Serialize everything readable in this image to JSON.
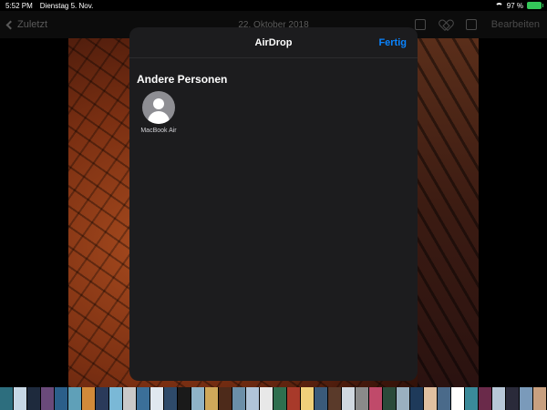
{
  "status_bar": {
    "time": "5:52 PM",
    "date": "Dienstag 5. Nov.",
    "battery": "97 %"
  },
  "nav_bar": {
    "back_label": "Zuletzt",
    "title": "22. Oktober 2018",
    "edit_label": "Bearbeiten"
  },
  "airdrop": {
    "title": "AirDrop",
    "done_label": "Fertig",
    "section_title": "Andere Personen",
    "people": [
      {
        "name": "MacBook Air"
      }
    ]
  },
  "colors": {
    "accent": "#0a84ff",
    "sheet_bg": "#1c1c1e",
    "battery": "#34c759"
  },
  "filmstrip": {
    "thumbs": [
      "#2d6e7e",
      "#c7d8e6",
      "#1e2a3d",
      "#6a4a7a",
      "#2b5f8a",
      "#5fa0b8",
      "#d18a3a",
      "#2a3a5a",
      "#7ab8d6",
      "#c9c9c9",
      "#3b6f99",
      "#e0e8f0",
      "#2e4a6a",
      "#1a1a1a",
      "#8fb3c7",
      "#cfa85a",
      "#4d2a1a",
      "#6b8fa8",
      "#b0c4d8",
      "#e8e8e8",
      "#2f6f4f",
      "#a83a2a",
      "#f0d07a",
      "#3a5a7a",
      "#5a3a2a",
      "#d0d8e0",
      "#8a8a8a",
      "#c04a6a",
      "#2a4a3a",
      "#9ab0c0",
      "#1e3a5a",
      "#e0c0a0",
      "#4a6a8a",
      "#ffffff",
      "#3a8a9a",
      "#6a2a4a",
      "#b8c8d8",
      "#2a2a3a",
      "#7a9aba",
      "#c8a080",
      "#ffffff",
      "#5a7a9a"
    ]
  }
}
